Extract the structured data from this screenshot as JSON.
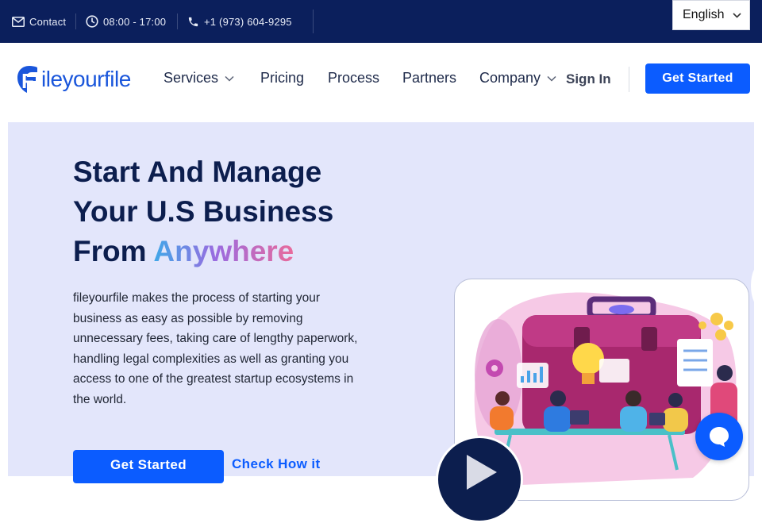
{
  "topbar": {
    "contact": "Contact",
    "hours": "08:00 - 17:00",
    "phone": "+1 (973) 604-9295",
    "language": "English"
  },
  "navbar": {
    "logo_text": "ileyourfile",
    "logo_letter": "F",
    "items": [
      {
        "label": "Services",
        "has_dropdown": true
      },
      {
        "label": "Pricing",
        "has_dropdown": false
      },
      {
        "label": "Process",
        "has_dropdown": false
      },
      {
        "label": "Partners",
        "has_dropdown": false
      },
      {
        "label": "Company",
        "has_dropdown": true
      }
    ],
    "signin": "Sign In",
    "cta": "Get Started"
  },
  "hero": {
    "title_line1": "Start And Manage",
    "title_line2": "Your U.S Business",
    "title_line3_plain": "From",
    "title_line3_gradient": "Anywhere",
    "description": "fileyourfile makes the process of starting your business as easy as possible by removing unnecessary fees, taking care of lengthy paperwork, handling legal complexities as well as granting you access to one of the greatest startup ecosystems in the world.",
    "cta": "Get Started",
    "secondary_link": "Check How it"
  },
  "colors": {
    "topbar_bg": "#0b1f5c",
    "brand_blue": "#0b5cff",
    "hero_bg": "#e3e6fb",
    "heading": "#0c1e4e"
  },
  "icons": [
    "mail-icon",
    "clock-icon",
    "phone-icon",
    "chevron-down-icon",
    "play-icon",
    "chat-icon"
  ]
}
